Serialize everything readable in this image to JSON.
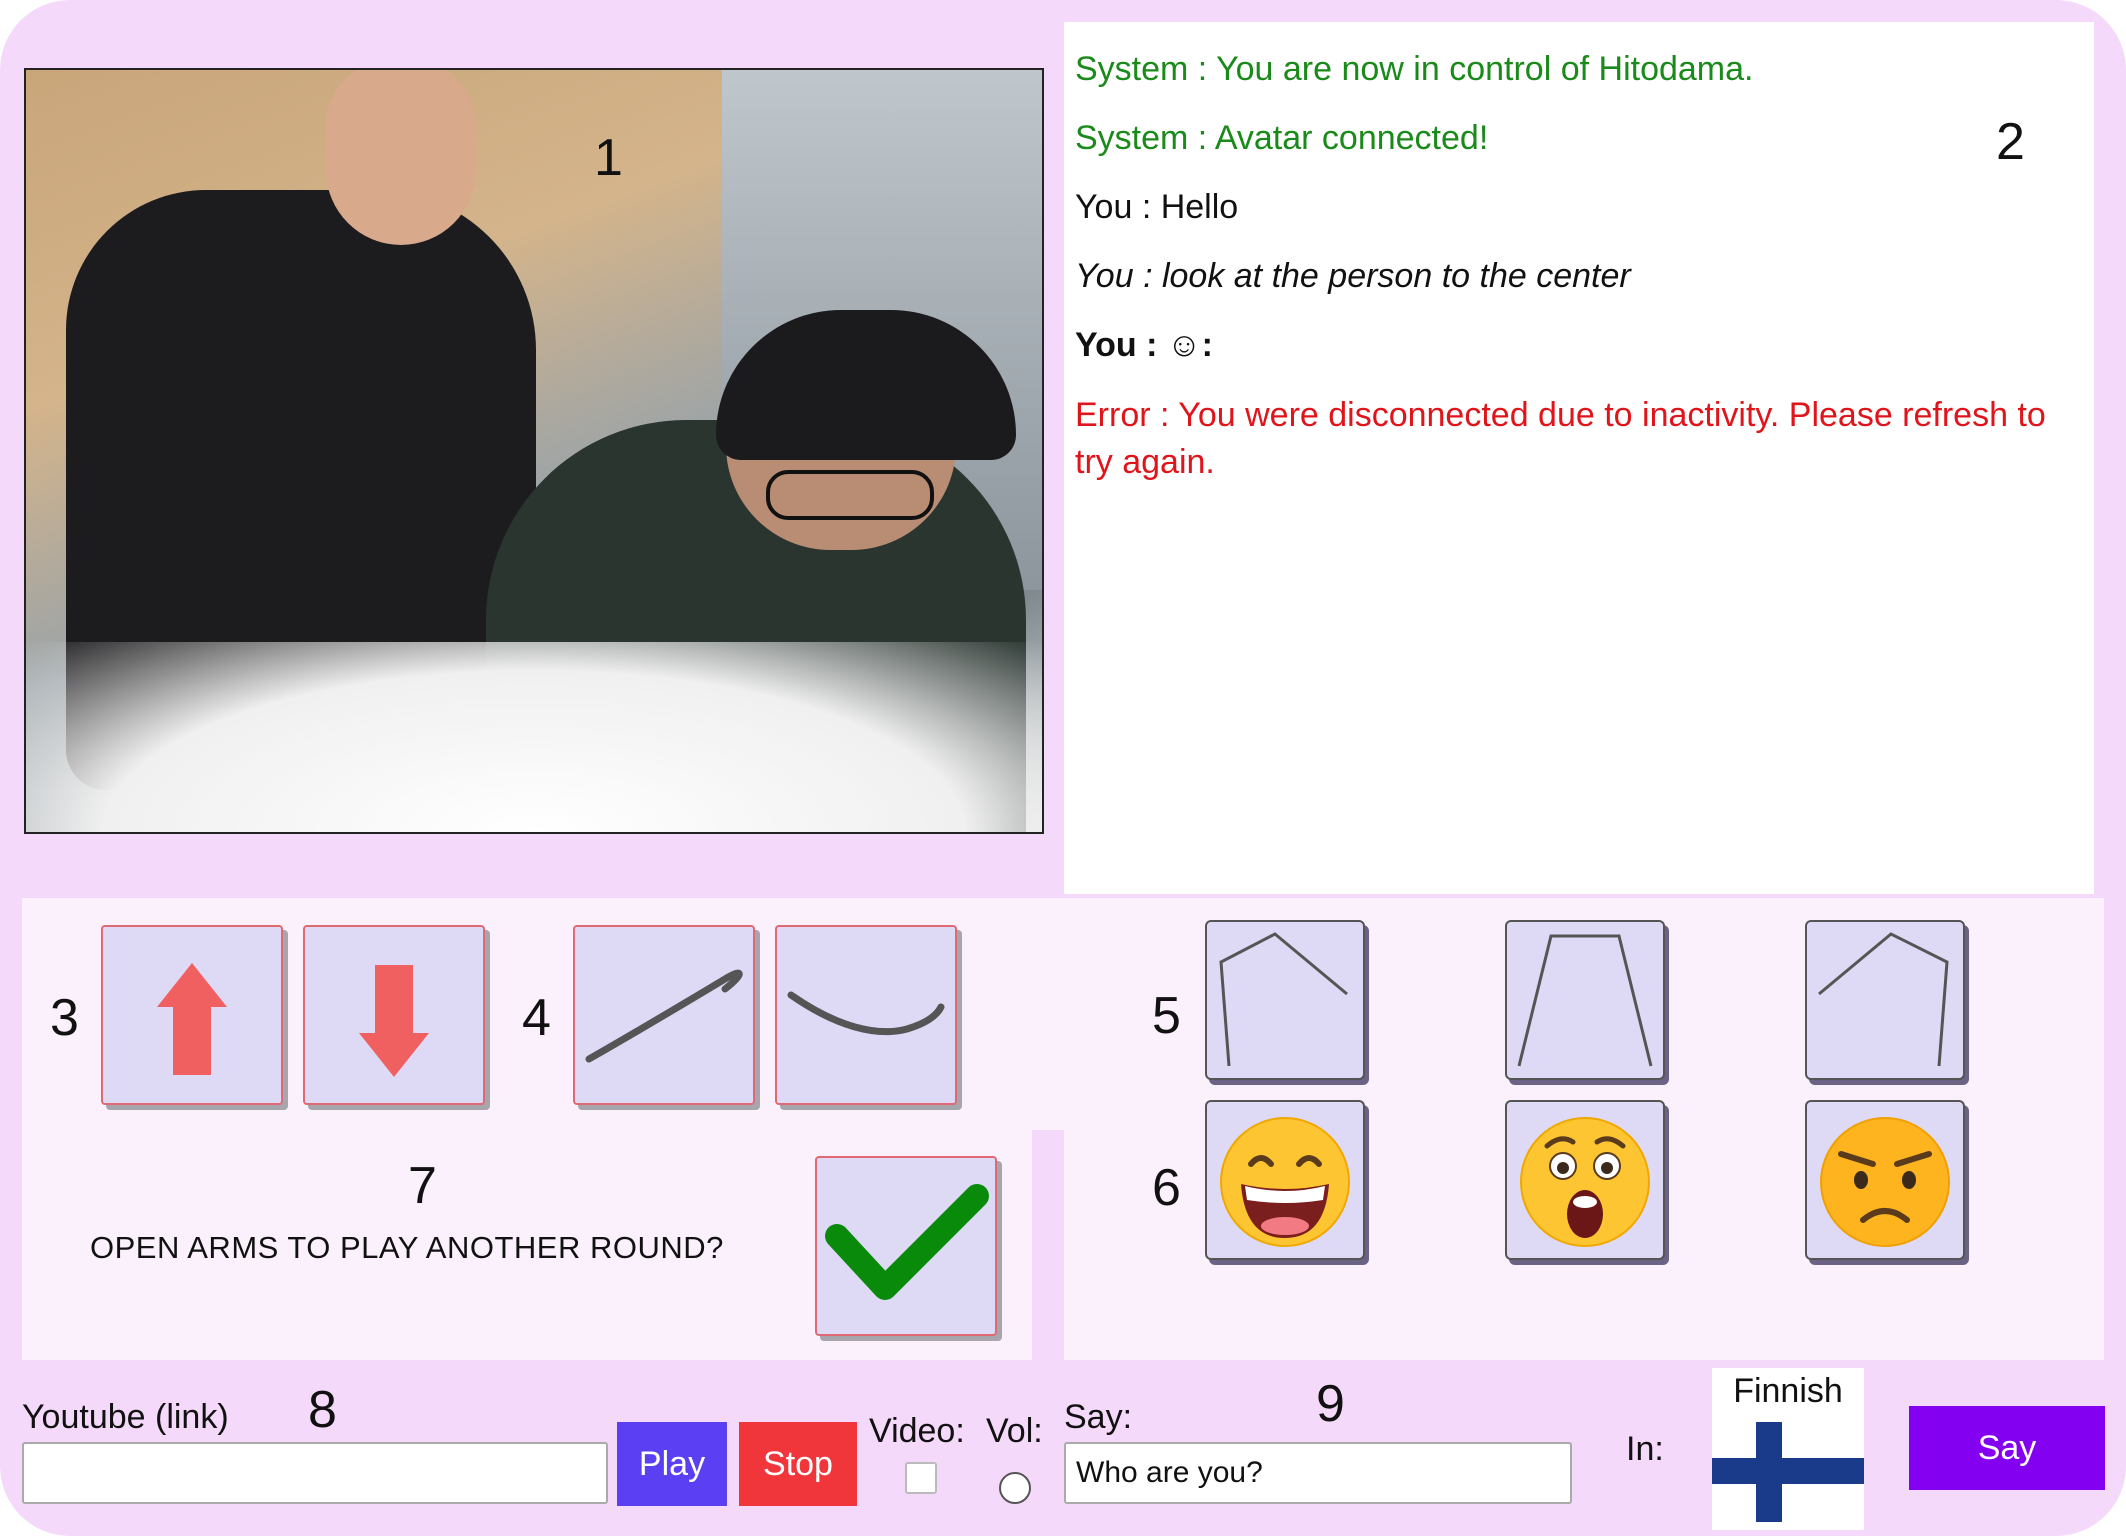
{
  "colors": {
    "panel_bg": "#f5d9fa",
    "system_msg": "#1a8a1a",
    "error_msg": "#e0151b",
    "play_btn": "#5b3ff2",
    "stop_btn": "#f0363b",
    "say_btn": "#8400f0",
    "arrow": "#f06060",
    "check": "#0a8a0a"
  },
  "video": {
    "number": "1"
  },
  "chat": {
    "number": "2",
    "messages": [
      {
        "text": "System : You are now in control of Hitodama."
      },
      {
        "text": "System : Avatar connected!"
      },
      {
        "text": "You : Hello"
      },
      {
        "text": "You : look at the person to the center"
      },
      {
        "text": "You : ☺:"
      },
      {
        "text": "Error : You were disconnected due to inactivity. Please refresh to"
      },
      {
        "text": "try again."
      }
    ]
  },
  "controls": {
    "head_number": "3",
    "head_buttons": [
      {
        "icon": "arrow-up-icon"
      },
      {
        "icon": "arrow-down-icon"
      }
    ],
    "arm_number": "4",
    "arm_buttons": [
      {
        "icon": "arm-curve-up-icon"
      },
      {
        "icon": "arm-curve-down-icon"
      }
    ],
    "pose_number": "5",
    "pose_buttons": [
      {
        "icon": "pose-open-left-icon"
      },
      {
        "icon": "pose-trapezoid-icon"
      },
      {
        "icon": "pose-open-right-icon"
      }
    ],
    "emotion_number": "6",
    "emotion_buttons": [
      {
        "icon": "grinning-face-icon"
      },
      {
        "icon": "surprised-face-icon"
      },
      {
        "icon": "angry-face-icon"
      }
    ],
    "confirm_number": "7",
    "confirm_question": "OPEN ARMS TO PLAY ANOTHER ROUND?",
    "confirm_icon": "checkmark-icon"
  },
  "bottom": {
    "youtube_label": "Youtube (link)",
    "youtube_number": "8",
    "youtube_value": "",
    "play_label": "Play",
    "stop_label": "Stop",
    "video_label": "Video:",
    "vol_label": "Vol:",
    "say_field_label": "Say:",
    "say_number": "9",
    "say_value": "Who are you?",
    "in_label": "In:",
    "language": "Finnish",
    "say_button": "Say"
  }
}
